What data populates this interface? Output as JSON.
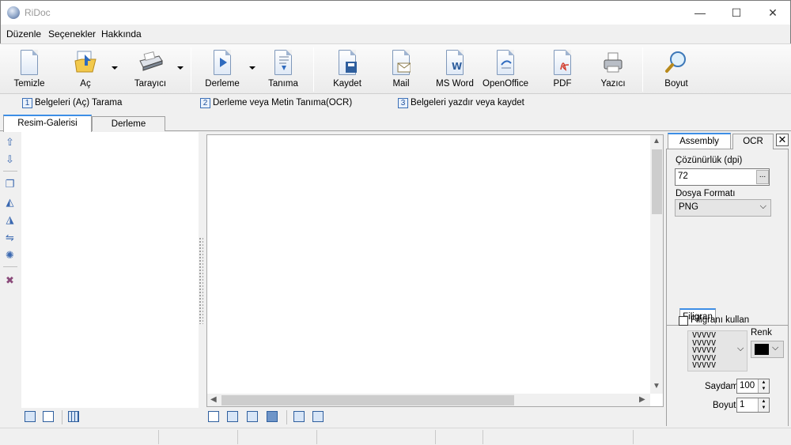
{
  "window": {
    "title": "RiDoc",
    "minimize": "—",
    "maximize": "☐",
    "close": "✕"
  },
  "menu": [
    "Düzenle",
    "Seçenekler",
    "Hakkında"
  ],
  "toolbar": {
    "buttons": [
      {
        "label": "Temizle",
        "icon": "blank-page-icon"
      },
      {
        "label": "Aç",
        "icon": "open-folder-icon"
      },
      {
        "label": "Tarayıcı",
        "icon": "scanner-icon"
      },
      {
        "label": "Derleme",
        "icon": "compile-icon"
      },
      {
        "label": "Tanıma",
        "icon": "recognize-icon"
      },
      {
        "label": "Kaydet",
        "icon": "save-icon"
      },
      {
        "label": "Mail",
        "icon": "mail-icon"
      },
      {
        "label": "MS Word",
        "icon": "word-icon"
      },
      {
        "label": "OpenOffice",
        "icon": "openoffice-icon"
      },
      {
        "label": "PDF",
        "icon": "pdf-icon"
      },
      {
        "label": "Yazıcı",
        "icon": "printer-icon"
      },
      {
        "label": "Boyut",
        "icon": "magnifier-icon"
      }
    ]
  },
  "steps": [
    {
      "num": "1",
      "text": "Belgeleri (Aç) Tarama"
    },
    {
      "num": "2",
      "text": "Derleme veya Metin Tanıma(OCR)"
    },
    {
      "num": "3",
      "text": "Belgeleri yazdır veya kaydet"
    }
  ],
  "tabs": {
    "gallery": "Resim-Galerisi",
    "compile": "Derleme"
  },
  "right_panel": {
    "tabs": {
      "assembly": "Assembly",
      "ocr": "OCR"
    },
    "close": "✕",
    "resolution_label": "Çözünürlük (dpi)",
    "resolution_value": "72",
    "browse": "...",
    "format_label": "Dosya Formatı",
    "format_value": "PNG",
    "watermark_tab": "Filigran",
    "use_watermark": "Filigranı kullan",
    "color_label": "Renk",
    "color_value": "#000000",
    "watermark_pattern": "VVVVV\nVVVVV\nVVVVV\nVVVVV\nVVVVV",
    "opacity_label": "Saydam",
    "opacity_value": "100",
    "size_label": "Boyut",
    "size_value": "1"
  },
  "colors": {
    "accent": "#3d8ee6"
  }
}
